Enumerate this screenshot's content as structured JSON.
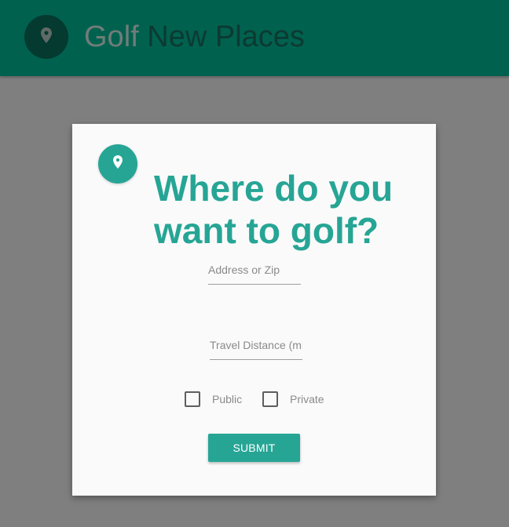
{
  "app_bar": {
    "title_first": "Golf",
    "title_rest": "New Places",
    "icon": "map-pin-icon"
  },
  "card": {
    "icon": "map-pin-icon",
    "heading": "Where do you want to golf?",
    "address_field": {
      "placeholder": "Address or Zip",
      "value": ""
    },
    "distance_field": {
      "placeholder": "Travel Distance (mi)",
      "value": ""
    },
    "checkboxes": [
      {
        "label": "Public",
        "checked": false
      },
      {
        "label": "Private",
        "checked": false
      }
    ],
    "submit_label": "SUBMIT"
  },
  "colors": {
    "app_bar": "#00614f",
    "accent": "#26a595",
    "backdrop": "#7f7f7f",
    "card": "#fafafa"
  }
}
